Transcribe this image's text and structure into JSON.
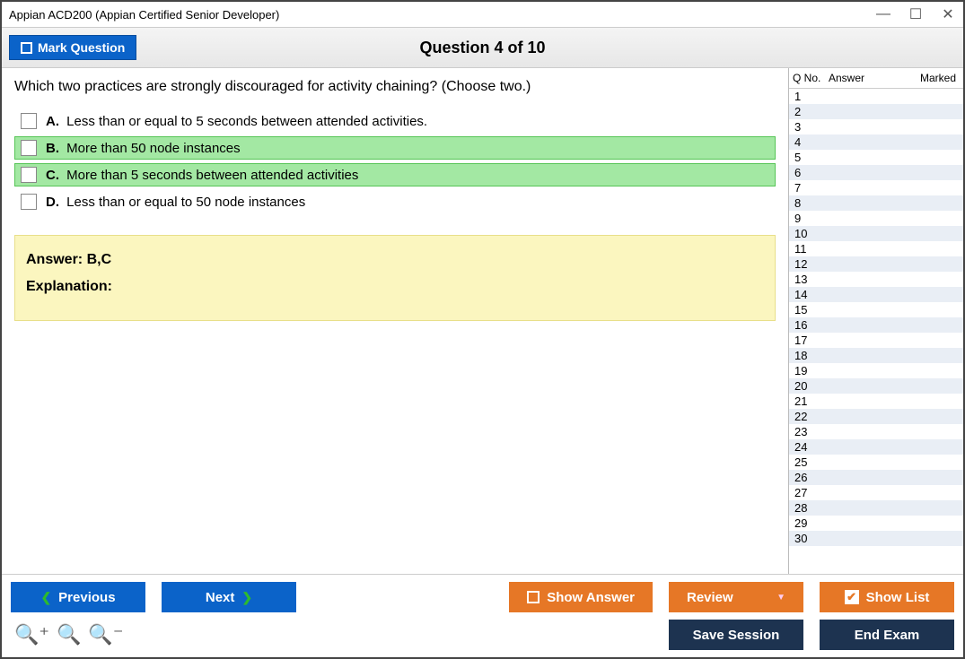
{
  "window": {
    "title": "Appian ACD200 (Appian Certified Senior Developer)"
  },
  "header": {
    "mark_label": "Mark Question",
    "question_title": "Question 4 of 10"
  },
  "question": {
    "text": "Which two practices are strongly discouraged for activity chaining? (Choose two.)",
    "options": [
      {
        "letter": "A.",
        "text": "Less than or equal to 5 seconds between attended activities.",
        "correct": false
      },
      {
        "letter": "B.",
        "text": "More than 50 node instances",
        "correct": true
      },
      {
        "letter": "C.",
        "text": "More than 5 seconds between attended activities",
        "correct": true
      },
      {
        "letter": "D.",
        "text": "Less than or equal to 50 node instances",
        "correct": false
      }
    ]
  },
  "answer_block": {
    "answer_label": "Answer: B,C",
    "explanation_label": "Explanation:"
  },
  "sidepanel": {
    "headers": {
      "qno": "Q No.",
      "answer": "Answer",
      "marked": "Marked"
    },
    "rows": [
      1,
      2,
      3,
      4,
      5,
      6,
      7,
      8,
      9,
      10,
      11,
      12,
      13,
      14,
      15,
      16,
      17,
      18,
      19,
      20,
      21,
      22,
      23,
      24,
      25,
      26,
      27,
      28,
      29,
      30
    ]
  },
  "buttons": {
    "previous": "Previous",
    "next": "Next",
    "show_answer": "Show Answer",
    "review": "Review",
    "show_list": "Show List",
    "save_session": "Save Session",
    "end_exam": "End Exam"
  },
  "zoom_icons": {
    "in": "zoom-in-icon",
    "reset": "zoom-icon",
    "out": "zoom-out-icon"
  }
}
